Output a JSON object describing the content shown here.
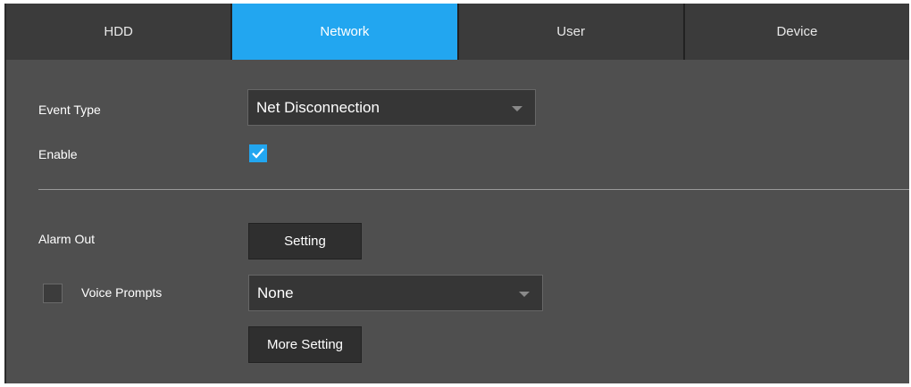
{
  "tabs": [
    {
      "label": "HDD",
      "active": false
    },
    {
      "label": "Network",
      "active": true
    },
    {
      "label": "User",
      "active": false
    },
    {
      "label": "Device",
      "active": false
    }
  ],
  "form": {
    "event_type_label": "Event Type",
    "event_type_value": "Net Disconnection",
    "enable_label": "Enable",
    "enable_checked": true,
    "alarm_out_label": "Alarm Out",
    "alarm_out_button": "Setting",
    "voice_prompts_label": "Voice Prompts",
    "voice_prompts_checked": false,
    "voice_prompts_value": "None",
    "more_setting_button": "More Setting"
  },
  "colors": {
    "accent": "#22a6f0",
    "panel_bg": "#4f4f4f",
    "tab_bg": "#3b3b3b"
  },
  "icons": {
    "dropdown": "chevron-down-icon",
    "check": "checkmark-icon"
  }
}
